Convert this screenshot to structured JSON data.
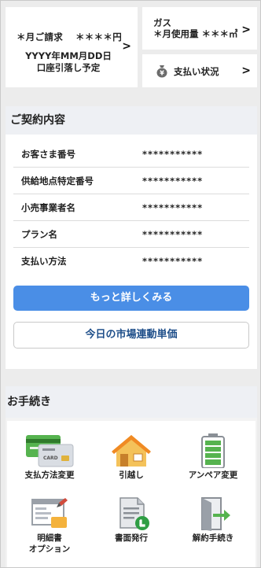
{
  "billing": {
    "month_label": "＊月ご請求",
    "amount": "＊＊＊＊円",
    "date_text": "YYYY年MM月DD日",
    "note": "口座引落し予定"
  },
  "gas": {
    "title": "ガス",
    "usage_label": "＊月使用量",
    "usage_value": "＊＊＊㎥"
  },
  "payment_status": {
    "label": "支払い状況"
  },
  "contract": {
    "title": "ご契約内容",
    "rows": [
      {
        "label": "お客さま番号",
        "value": "***********"
      },
      {
        "label": "供給地点特定番号",
        "value": "***********"
      },
      {
        "label": "小売事業者名",
        "value": "***********"
      },
      {
        "label": "プラン名",
        "value": "***********"
      },
      {
        "label": "支払い方法",
        "value": "***********"
      }
    ],
    "more_button": "もっと詳しくみる",
    "market_price_button": "今日の市場連動単価"
  },
  "procedures": {
    "title": "お手続き",
    "items": [
      {
        "label": "支払方法変更",
        "icon": "card-icon"
      },
      {
        "label": "引越し",
        "icon": "house-icon"
      },
      {
        "label": "アンペア変更",
        "icon": "battery-icon"
      },
      {
        "label": "明細書",
        "label2": "オプション",
        "icon": "statement-icon"
      },
      {
        "label": "書面発行",
        "icon": "document-icon"
      },
      {
        "label": "解約手続き",
        "icon": "exit-door-icon"
      }
    ]
  },
  "colors": {
    "primary": "#4a8ee6",
    "link_text": "#1f4f8a",
    "background": "#ececec"
  }
}
